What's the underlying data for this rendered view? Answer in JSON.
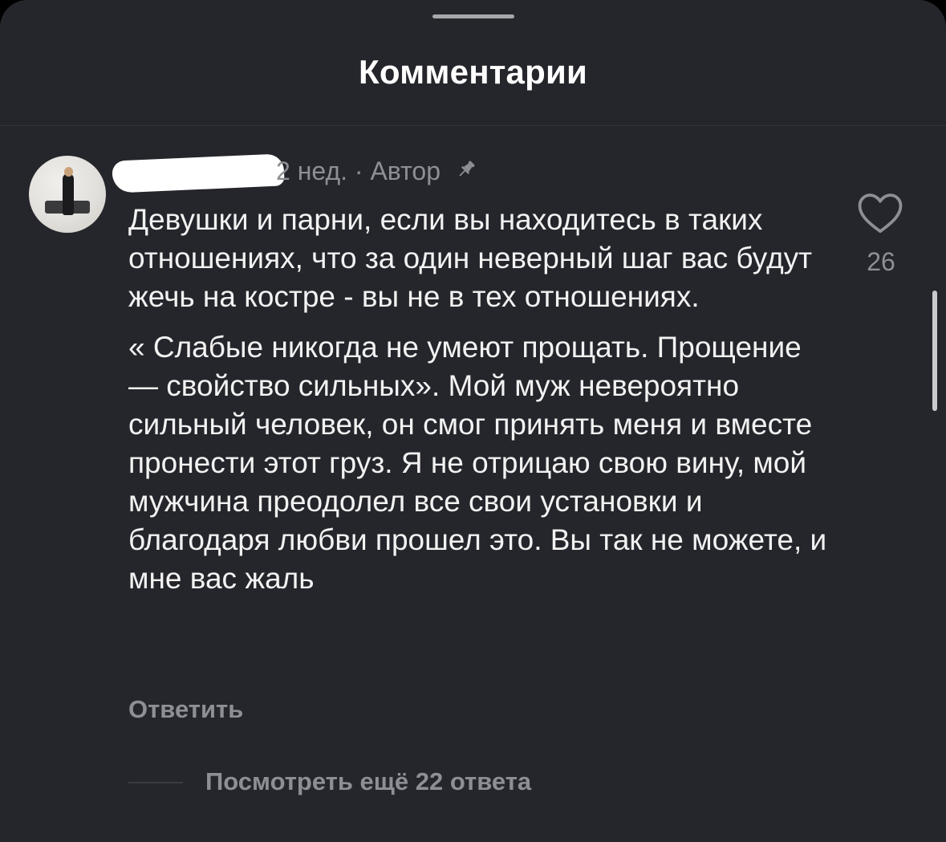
{
  "sheet": {
    "title": "Комментарии"
  },
  "comment": {
    "time": "2 нед.",
    "separator": "·",
    "author_badge": "Автор",
    "paragraphs": [
      "Девушки и парни, если вы находитесь в таких отношениях, что за один неверный шаг вас будут жечь на костре - вы не в тех отношениях.",
      "« Слабые никогда не умеют прощать. Прощение — свойство сильных». Мой муж невероятно сильный человек, он смог принять меня и вместе пронести этот груз. Я не отрицаю свою вину, мой мужчина преодолел все свои установки и благодаря любви прошел это. Вы так не можете, и мне вас жаль"
    ],
    "likes": "26",
    "reply_label": "Ответить",
    "view_more_label": "Посмотреть ещё 22 ответа"
  },
  "icons": {
    "like": "heart-icon",
    "pin": "pin-icon"
  },
  "colors": {
    "background": "#25262b",
    "text_primary": "#f2f2f2",
    "text_secondary": "#8e8f94"
  }
}
